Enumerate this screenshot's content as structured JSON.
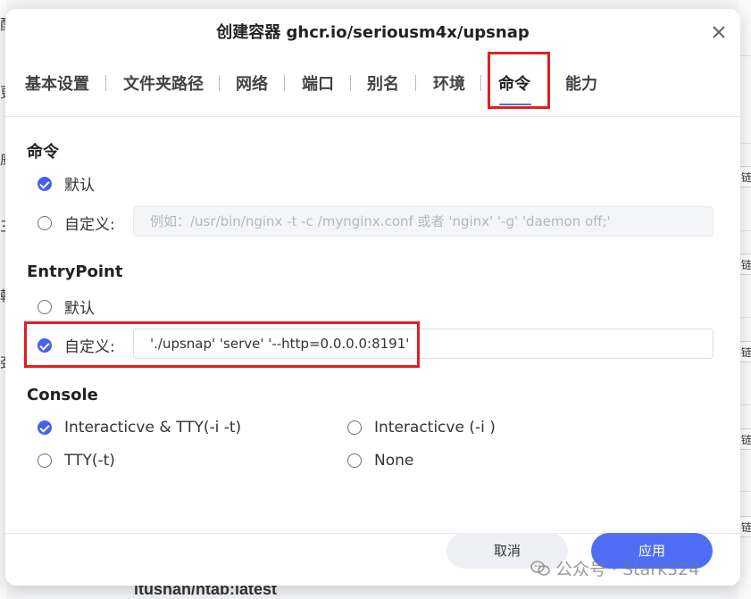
{
  "background": {
    "left_glyphs": [
      "配",
      "更",
      "威",
      "三",
      "韩",
      "劲"
    ],
    "right_button_label": "链接",
    "bottom_text": "ltushan/ntab:latest"
  },
  "dialog": {
    "title": "创建容器 ghcr.io/seriousm4x/upsnap",
    "close_icon": "close-icon"
  },
  "tabs": [
    {
      "label": "基本设置"
    },
    {
      "label": "文件夹路径"
    },
    {
      "label": "网络"
    },
    {
      "label": "端口"
    },
    {
      "label": "别名"
    },
    {
      "label": "环境"
    },
    {
      "label": "命令",
      "active": true
    },
    {
      "label": "能力"
    }
  ],
  "command": {
    "title": "命令",
    "default_label": "默认",
    "default_checked": true,
    "custom_label": "自定义:",
    "custom_checked": false,
    "custom_placeholder": "例如：/usr/bin/nginx -t -c /mynginx.conf 或者 'nginx' '-g' 'daemon off;'"
  },
  "entrypoint": {
    "title": "EntryPoint",
    "default_label": "默认",
    "default_checked": false,
    "custom_label": "自定义:",
    "custom_checked": true,
    "custom_value": "'./upsnap' 'serve' '--http=0.0.0.0:8191'"
  },
  "console": {
    "title": "Console",
    "options": [
      {
        "label": "Interacticve & TTY(-i -t)",
        "checked": true
      },
      {
        "label": "Interacticve (-i )",
        "checked": false
      },
      {
        "label": "TTY(-t)",
        "checked": false
      },
      {
        "label": "None",
        "checked": false
      }
    ]
  },
  "footer": {
    "cancel_label": "取消",
    "apply_label": "应用"
  },
  "watermark": {
    "text": "公众号 · Stark324",
    "icon": "wechat-icon"
  },
  "colors": {
    "accent": "#4562ee",
    "highlight": "#e02020",
    "apply_button": "#4f6ef5"
  }
}
